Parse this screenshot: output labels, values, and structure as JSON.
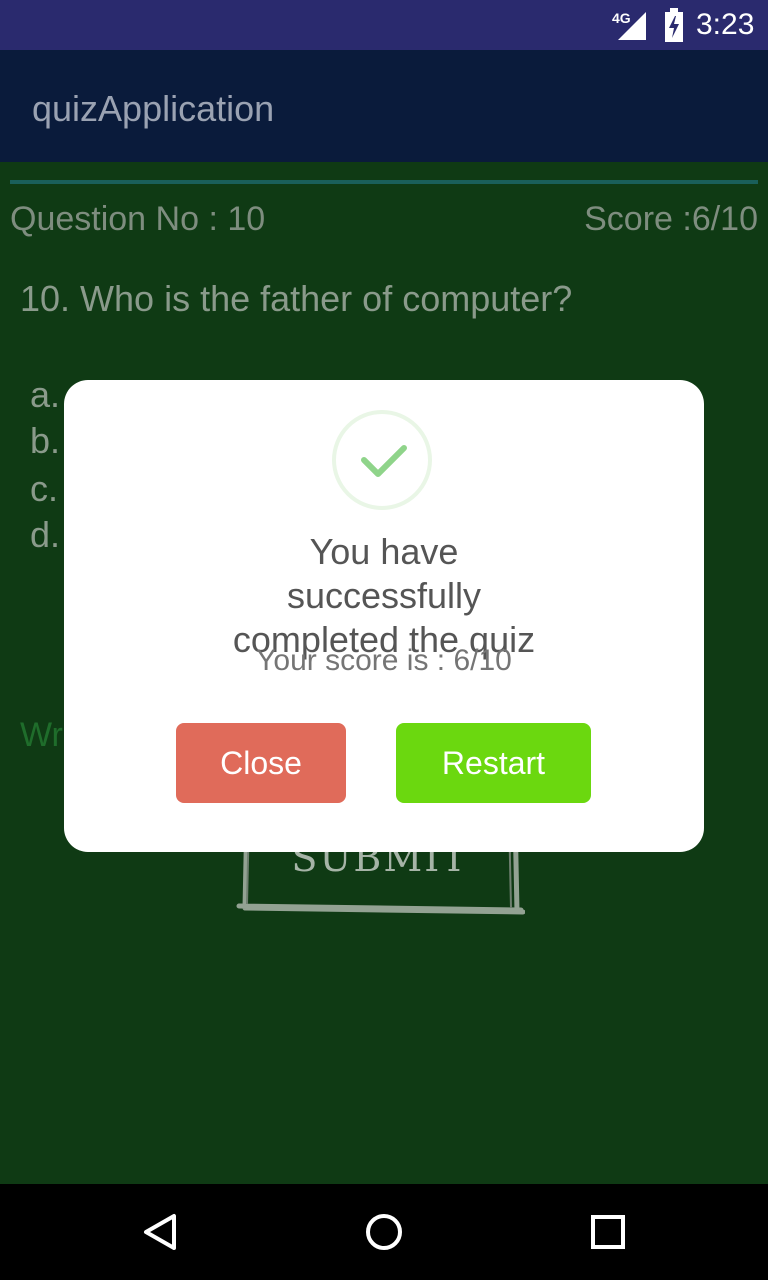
{
  "status_bar": {
    "network": "4G",
    "time": "3:23"
  },
  "app": {
    "title": "quizApplication"
  },
  "quiz": {
    "question_no_label": "Question No : 10",
    "score_label": "Score :6/10",
    "question_text": "10. Who is the father of computer?",
    "options": [
      {
        "label": "a."
      },
      {
        "label": "b."
      },
      {
        "label": "c."
      },
      {
        "label": "d."
      }
    ],
    "wrong_text_partial": "Wr",
    "submit_label": "SUBMIT"
  },
  "dialog": {
    "title": "You have successfully completed the quiz",
    "score_text": "Your score is : 6/10",
    "close_label": "Close",
    "restart_label": "Restart",
    "accent_green": "#6bd80f",
    "accent_red": "#e06b5a"
  },
  "nav": {
    "back_icon": "back-triangle-icon",
    "home_icon": "home-circle-icon",
    "recents_icon": "recents-square-icon"
  }
}
